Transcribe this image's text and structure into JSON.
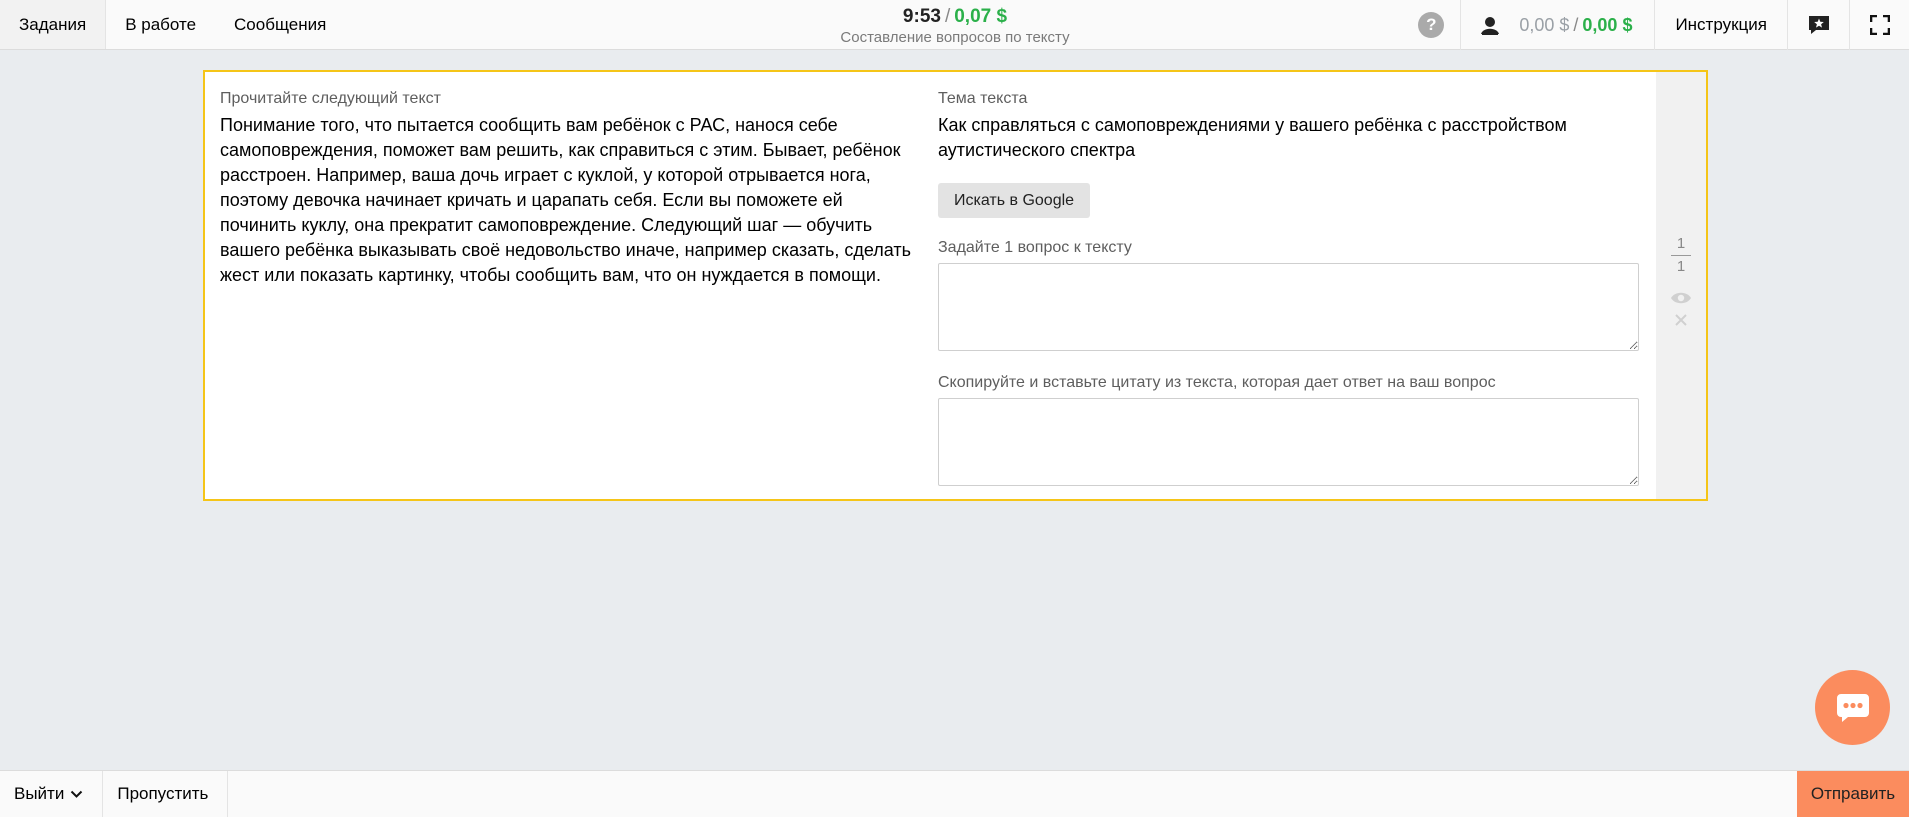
{
  "topbar": {
    "nav": [
      {
        "label": "Задания"
      },
      {
        "label": "В работе"
      },
      {
        "label": "Сообщения"
      }
    ],
    "timer": "9:53",
    "separator": "/",
    "reward": "0,07 $",
    "task_title": "Составление вопросов по тексту",
    "help_symbol": "?",
    "balance_left": "0,00 $",
    "balance_sep": "/",
    "balance_right": "0,00 $",
    "instruction_label": "Инструкция"
  },
  "task": {
    "text_label": "Прочитайте следующий текст",
    "text_body": "Понимание того, что пытается сообщить вам ребёнок с РАС, нанося себе самоповреждения, поможет вам решить, как справиться с этим. Бывает, ребёнок расстроен. Например, ваша дочь играет с куклой, у которой отрывается нога, поэтому девочка начинает кричать и царапать себя. Если вы поможете ей починить куклу, она прекратит самоповреждение. Следующий шаг — обучить вашего ребёнка выказывать своё недовольство иначе, например сказать, сделать жест или показать картинку, чтобы сообщить вам, что он нуждается в помощи.",
    "topic_label": "Тема текста",
    "topic": "Как справляться с самоповреждениями у вашего ребёнка с расстройством аутистического спектра",
    "google_button": "Искать в Google",
    "question_label": "Задайте 1 вопрос к тексту",
    "question_value": "",
    "quote_label": "Скопируйте и вставьте цитату из текста, которая дает ответ на ваш вопрос",
    "quote_value": "",
    "counter_current": "1",
    "counter_total": "1"
  },
  "bottombar": {
    "exit_label": "Выйти",
    "skip_label": "Пропустить",
    "submit_label": "Отправить"
  },
  "colors": {
    "accent": "#fb8c5e",
    "card_border": "#f5c518",
    "money_green": "#2bb04a"
  },
  "icons": {
    "user": "user-icon",
    "feedback": "chat-star-icon",
    "fullscreen": "fullscreen-icon",
    "eye": "eye-icon",
    "close": "close-icon",
    "chat": "chat-bubble-icon",
    "chevron": "chevron-down-icon"
  }
}
